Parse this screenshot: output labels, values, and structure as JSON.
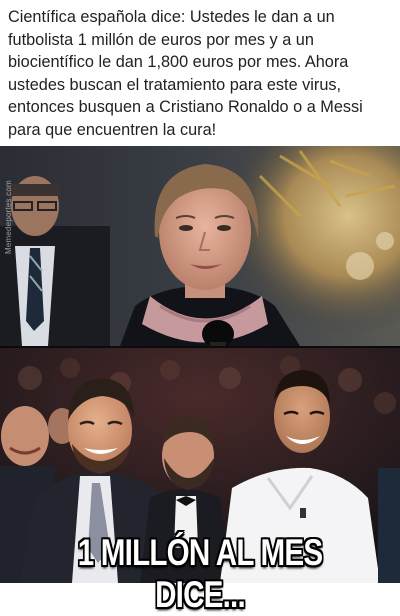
{
  "meme": {
    "top_caption": "Científica española dice: Ustedes le dan a un futbolista 1 millón de euros por mes y a un biocientífico le dan 1,800 euros por mes. Ahora ustedes buscan el tratamiento para este virus, entonces busquen a Cristiano Ronaldo o a Messi para que encuentren la cura!",
    "watermark": "Memedeportes.com",
    "bottom_caption": "1 MILLÓN AL MES DICE..."
  }
}
